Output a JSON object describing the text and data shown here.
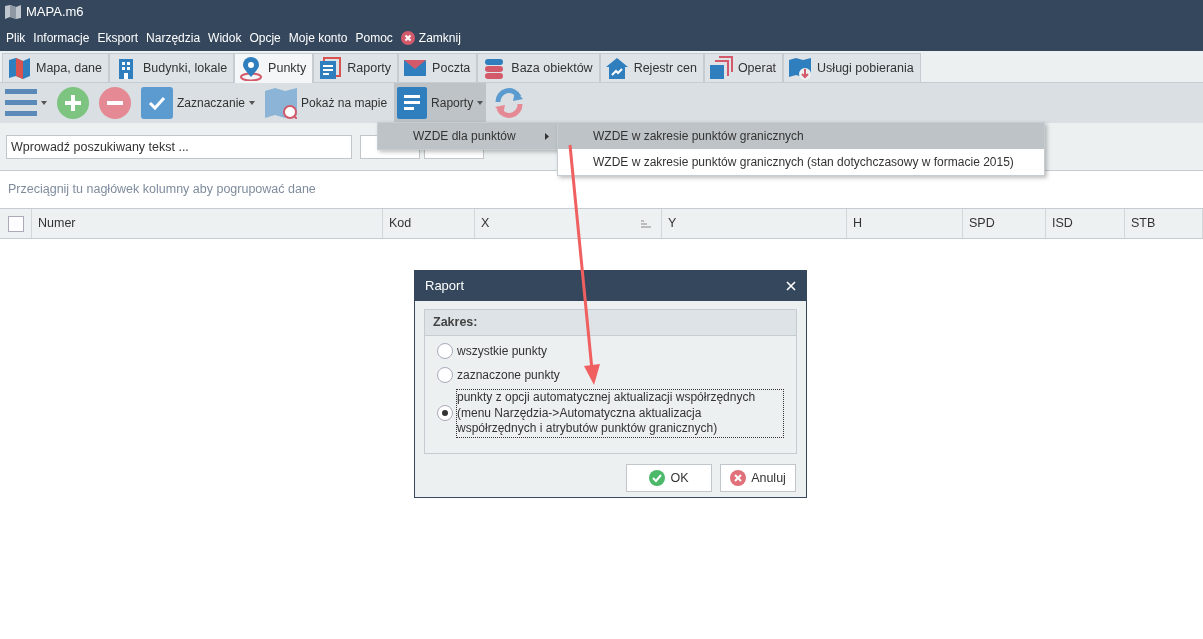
{
  "window": {
    "title": "MAPA.m6"
  },
  "menu": [
    {
      "label": "Plik",
      "kind": "item"
    },
    {
      "label": "Informacje",
      "kind": "item"
    },
    {
      "label": "Eksport",
      "kind": "item"
    },
    {
      "label": "Narzędzia",
      "kind": "item"
    },
    {
      "label": "Widok",
      "kind": "item"
    },
    {
      "label": "Opcje",
      "kind": "item"
    },
    {
      "label": "Moje konto",
      "kind": "item"
    },
    {
      "label": "Pomoc",
      "kind": "item"
    },
    {
      "label": "Zamknij",
      "kind": "close"
    }
  ],
  "tabs": [
    {
      "label": "Mapa, dane",
      "kind": "map",
      "selected": false
    },
    {
      "label": "Budynki, lokale",
      "kind": "building",
      "selected": false
    },
    {
      "label": "Punkty",
      "kind": "pin",
      "selected": true
    },
    {
      "label": "Raporty",
      "kind": "report",
      "selected": false
    },
    {
      "label": "Poczta",
      "kind": "mail",
      "selected": false
    },
    {
      "label": "Baza obiektów",
      "kind": "database",
      "selected": false
    },
    {
      "label": "Rejestr cen",
      "kind": "house",
      "selected": false
    },
    {
      "label": "Operat",
      "kind": "pages",
      "selected": false
    },
    {
      "label": "Usługi pobierania",
      "kind": "download",
      "selected": false
    }
  ],
  "toolbar": [
    {
      "kind": "list",
      "dropdown": true,
      "selected": false
    },
    {
      "kind": "add",
      "dropdown": false,
      "selected": false
    },
    {
      "kind": "remove",
      "dropdown": false,
      "selected": false
    },
    {
      "kind": "check",
      "label": "Zaznaczanie",
      "dropdown": true,
      "selected": false
    },
    {
      "kind": "map",
      "label": "Pokaż na mapie",
      "dropdown": false,
      "selected": false
    },
    {
      "kind": "report",
      "label": "Raporty",
      "dropdown": true,
      "selected": true
    },
    {
      "kind": "refresh",
      "dropdown": false,
      "selected": false
    }
  ],
  "search": {
    "placeholder": "Wprowadź poszukiwany tekst ..."
  },
  "group_hint": "Przeciągnij tu nagłówek kolumny aby pogrupować dane",
  "table": {
    "select_all": {
      "checked": false
    },
    "columns": [
      {
        "label": "Numer",
        "sorted": false
      },
      {
        "label": "Kod",
        "sorted": false
      },
      {
        "label": "X",
        "sorted": true
      },
      {
        "label": "Y",
        "sorted": false
      },
      {
        "label": "H",
        "sorted": false
      },
      {
        "label": "SPD",
        "sorted": false
      },
      {
        "label": "ISD",
        "sorted": false
      },
      {
        "label": "STB",
        "sorted": false
      }
    ]
  },
  "popup_menu": {
    "items": [
      {
        "label": "WZDE dla punktów",
        "submenu": true,
        "selected": true
      }
    ]
  },
  "submenu": {
    "items": [
      {
        "label": "WZDE w zakresie punktów granicznych",
        "selected": true
      },
      {
        "label": "WZDE w zakresie punktów granicznych (stan dotychczasowy w formacie 2015)",
        "selected": false
      }
    ]
  },
  "dialog": {
    "title": "Raport",
    "group_title": "Zakres:",
    "options": [
      {
        "label": "wszystkie punkty",
        "selected": false
      },
      {
        "label": "zaznaczone punkty",
        "selected": false
      },
      {
        "label": "punkty z opcji automatycznej aktualizacji współrzędnych (menu Narzędzia->Automatyczna aktualizacja współrzędnych i atrybutów punktów granicznych)",
        "selected": true
      }
    ],
    "buttons": [
      {
        "label": "OK",
        "kind": "ok"
      },
      {
        "label": "Anuluj",
        "kind": "cancel"
      }
    ]
  }
}
